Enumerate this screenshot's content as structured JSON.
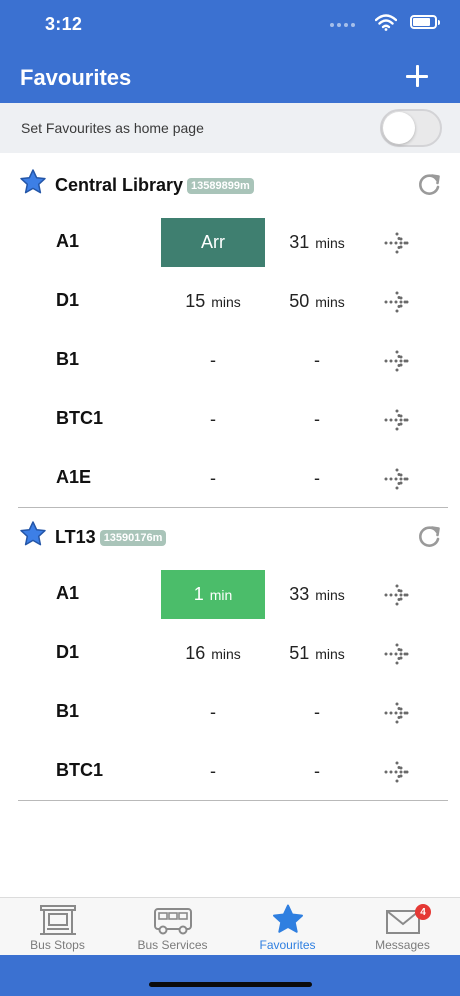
{
  "status": {
    "time": "3:12"
  },
  "header": {
    "title": "Favourites"
  },
  "home_setting": {
    "label": "Set Favourites as home page",
    "enabled": false
  },
  "colors": {
    "header": "#3b71d1",
    "arrived": "#3f7f70",
    "soon": "#4bbd6a",
    "active_tab": "#2f7fe0",
    "star": "#3d7fe6"
  },
  "stops": [
    {
      "name": "Central Library",
      "code": "13589899m",
      "services": [
        {
          "service": "A1",
          "first": "Arr",
          "first_unit": "",
          "first_style": "arr",
          "second": "31",
          "second_unit": "mins"
        },
        {
          "service": "D1",
          "first": "15",
          "first_unit": "mins",
          "first_style": "",
          "second": "50",
          "second_unit": "mins"
        },
        {
          "service": "B1",
          "first": "-",
          "first_unit": "",
          "first_style": "",
          "second": "-",
          "second_unit": ""
        },
        {
          "service": "BTC1",
          "first": "-",
          "first_unit": "",
          "first_style": "",
          "second": "-",
          "second_unit": ""
        },
        {
          "service": "A1E",
          "first": "-",
          "first_unit": "",
          "first_style": "",
          "second": "-",
          "second_unit": ""
        }
      ]
    },
    {
      "name": "LT13",
      "code": "13590176m",
      "services": [
        {
          "service": "A1",
          "first": "1",
          "first_unit": "min",
          "first_style": "soon",
          "second": "33",
          "second_unit": "mins"
        },
        {
          "service": "D1",
          "first": "16",
          "first_unit": "mins",
          "first_style": "",
          "second": "51",
          "second_unit": "mins"
        },
        {
          "service": "B1",
          "first": "-",
          "first_unit": "",
          "first_style": "",
          "second": "-",
          "second_unit": ""
        },
        {
          "service": "BTC1",
          "first": "-",
          "first_unit": "",
          "first_style": "",
          "second": "-",
          "second_unit": ""
        }
      ]
    }
  ],
  "tabs": [
    {
      "label": "Bus Stops",
      "icon": "bus-stop-icon"
    },
    {
      "label": "Bus Services",
      "icon": "bus-icon"
    },
    {
      "label": "Favourites",
      "icon": "star-icon",
      "active": true
    },
    {
      "label": "Messages",
      "icon": "mail-icon",
      "badge": "4"
    }
  ]
}
